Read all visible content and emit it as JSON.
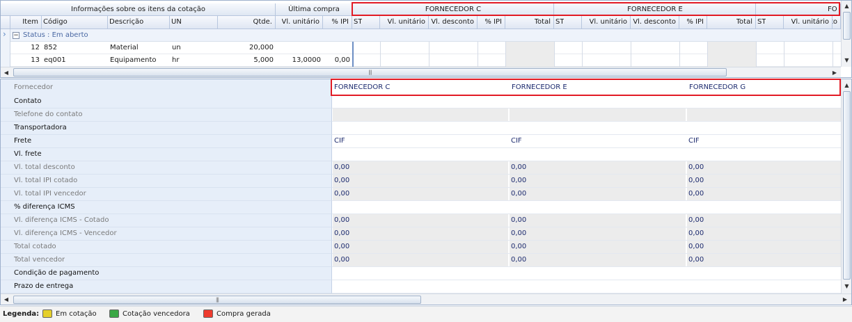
{
  "top_grid": {
    "band_headers": {
      "info": "Informações sobre os itens da cotação",
      "last_purchase": "Última compra",
      "supplier_c": "FORNECEDOR C",
      "supplier_e": "FORNECEDOR E",
      "supplier_g_partial": "FO"
    },
    "columns": {
      "item": "Item",
      "code": "Código",
      "description": "Descrição",
      "unit": "UN",
      "qty": "Qtde.",
      "last_unit_value": "Vl. unitário",
      "last_ipi": "% IPI",
      "st": "ST",
      "unit_value": "Vl. unitário",
      "discount_value": "Vl. desconto",
      "ipi": "% IPI",
      "total": "Total"
    },
    "group_row": {
      "label": "Status : Em aberto",
      "toggle": "−"
    },
    "rows": [
      {
        "item": "12",
        "code": "852",
        "description": "Material",
        "unit": "un",
        "qty": "20,000",
        "last_unit_value": "",
        "last_ipi": ""
      },
      {
        "item": "13",
        "code": "eq001",
        "description": "Equipamento",
        "unit": "hr",
        "qty": "5,000",
        "last_unit_value": "13,0000",
        "last_ipi": "0,00"
      }
    ]
  },
  "bottom_grid": {
    "header_label": "Fornecedor",
    "suppliers": [
      "FORNECEDOR C",
      "FORNECEDOR E",
      "FORNECEDOR G"
    ],
    "rows": [
      {
        "label": "Contato",
        "bold": true,
        "values": [
          "",
          "",
          ""
        ],
        "gray": false
      },
      {
        "label": "Telefone do contato",
        "bold": false,
        "values": [
          "",
          "",
          ""
        ],
        "gray": true
      },
      {
        "label": "Transportadora",
        "bold": true,
        "values": [
          "",
          "",
          ""
        ],
        "gray": false
      },
      {
        "label": "Frete",
        "bold": true,
        "values": [
          "CIF",
          "CIF",
          "CIF"
        ],
        "gray": false
      },
      {
        "label": "Vl. frete",
        "bold": true,
        "values": [
          "",
          "",
          ""
        ],
        "gray": false
      },
      {
        "label": "Vl. total desconto",
        "bold": false,
        "values": [
          "0,00",
          "0,00",
          "0,00"
        ],
        "gray": true
      },
      {
        "label": "Vl. total IPI cotado",
        "bold": false,
        "values": [
          "0,00",
          "0,00",
          "0,00"
        ],
        "gray": true
      },
      {
        "label": "Vl. total IPI vencedor",
        "bold": false,
        "values": [
          "0,00",
          "0,00",
          "0,00"
        ],
        "gray": true
      },
      {
        "label": "% diferença ICMS",
        "bold": true,
        "values": [
          "",
          "",
          ""
        ],
        "gray": false
      },
      {
        "label": "Vl. diferença ICMS - Cotado",
        "bold": false,
        "values": [
          "0,00",
          "0,00",
          "0,00"
        ],
        "gray": true
      },
      {
        "label": "Vl. diferença ICMS - Vencedor",
        "bold": false,
        "values": [
          "0,00",
          "0,00",
          "0,00"
        ],
        "gray": true
      },
      {
        "label": "Total cotado",
        "bold": false,
        "values": [
          "0,00",
          "0,00",
          "0,00"
        ],
        "gray": true
      },
      {
        "label": "Total vencedor",
        "bold": false,
        "values": [
          "0,00",
          "0,00",
          "0,00"
        ],
        "gray": true
      },
      {
        "label": "Condição de pagamento",
        "bold": true,
        "values": [
          "",
          "",
          ""
        ],
        "gray": false
      },
      {
        "label": "Prazo de entrega",
        "bold": true,
        "values": [
          "",
          "",
          ""
        ],
        "gray": false
      }
    ]
  },
  "legend": {
    "title": "Legenda:",
    "items": [
      {
        "label": "Em cotação",
        "color": "#e5cf2a"
      },
      {
        "label": "Cotação vencedora",
        "color": "#3aa845"
      },
      {
        "label": "Compra gerada",
        "color": "#ee3b2e"
      }
    ]
  },
  "scroll_glyphs": {
    "left": "◀",
    "right": "▶",
    "up": "▲",
    "down": "▼",
    "grip": "|||",
    "row_indicator": "›"
  },
  "colors": {
    "highlight_border": "#e21a24",
    "header_text": "#1a1a1a",
    "supplier_text": "#1c2a6e",
    "label_bg": "#e6eef9",
    "gray_cell": "#ececec"
  }
}
